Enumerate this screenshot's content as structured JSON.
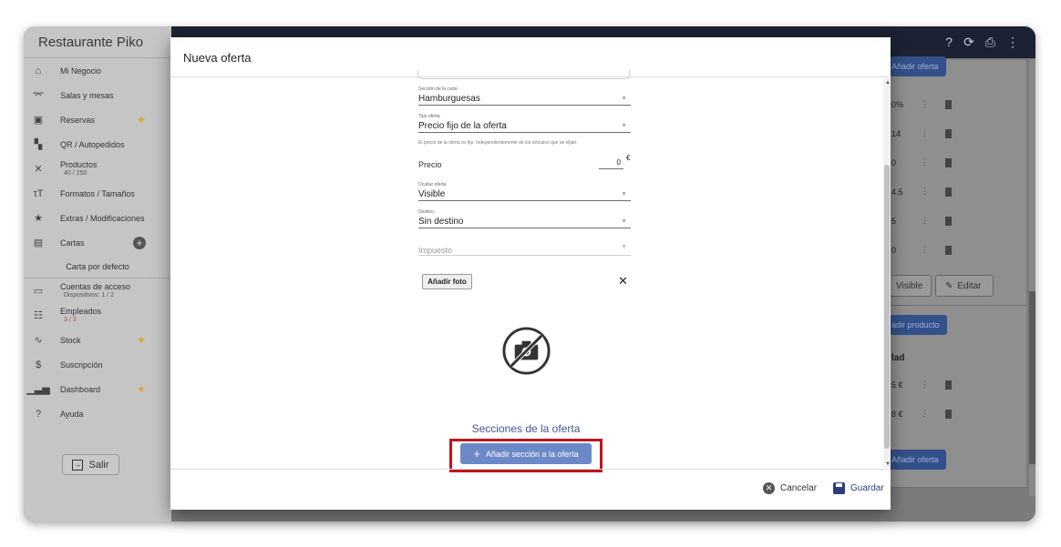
{
  "app": {
    "title": "Restaurante Piko"
  },
  "sidebar": {
    "items": [
      {
        "label": "Mi Negocio",
        "icon": "home-icon",
        "glyph": "⌂"
      },
      {
        "label": "Salas y mesas",
        "icon": "table-icon",
        "glyph": "⌤"
      },
      {
        "label": "Reservas",
        "icon": "calendar-icon",
        "glyph": "▣",
        "starred": true
      },
      {
        "label": "QR / Autopedidos",
        "icon": "qr-icon",
        "glyph": "▚"
      },
      {
        "label": "Productos",
        "sub": "40 / 250",
        "icon": "utensils-icon",
        "glyph": "✕"
      },
      {
        "label": "Formatos / Tamaños",
        "icon": "text-size-icon",
        "glyph": "τT"
      },
      {
        "label": "Extras / Modificaciones",
        "icon": "star-icon",
        "glyph": "★"
      },
      {
        "label": "Cartas",
        "icon": "menu-book-icon",
        "glyph": "▤",
        "plus": true
      }
    ],
    "default_menu": "Carta por defecto",
    "items2": [
      {
        "label": "Cuentas de acceso",
        "sub": "Dispositivos: 1 / 2",
        "icon": "devices-icon",
        "glyph": "▭"
      },
      {
        "label": "Empleados",
        "sub": "3 / 3",
        "icon": "people-icon",
        "glyph": "☷"
      },
      {
        "label": "Stock",
        "icon": "trend-icon",
        "glyph": "∿",
        "starred": true
      },
      {
        "label": "Suscripción",
        "icon": "dollar-icon",
        "glyph": "$"
      },
      {
        "label": "Dashboard",
        "icon": "bar-chart-icon",
        "glyph": "▁▃▅",
        "starred": true
      },
      {
        "label": "Ayuda",
        "icon": "help-icon",
        "glyph": "?"
      }
    ],
    "logout_label": "Salir"
  },
  "background": {
    "add_offer": "Añadir oferta",
    "rows": [
      "0%",
      "14",
      "0",
      "4.5",
      "5",
      "0"
    ],
    "visible_label": "Visible",
    "edit_label": "Editar",
    "add_product": "adir producto",
    "section_label": "lad",
    "rows2": [
      "5 €",
      "8 €"
    ],
    "add_offer2": "Añadir oferta"
  },
  "modal": {
    "title": "Nueva oferta",
    "fields": {
      "section": {
        "label": "Sección de la carta",
        "value": "Hamburguesas"
      },
      "type": {
        "label": "Tipo oferta",
        "value": "Precio fijo de la oferta"
      },
      "help": "El precio de la oferta es fijo. Independientemente de los artículos que se elijan.",
      "price": {
        "label": "Precio",
        "value": "0",
        "unit": "€"
      },
      "hide": {
        "label": "Ocultar oferta",
        "value": "Visible"
      },
      "destination": {
        "label": "Destino",
        "value": "Sin destino"
      },
      "tax": {
        "placeholder": "Impuesto"
      }
    },
    "add_photo": "Añadir foto",
    "sections_title": "Secciones de la oferta",
    "add_section": "Añadir sección a la oferta",
    "cancel": "Cancelar",
    "save": "Guardar"
  }
}
